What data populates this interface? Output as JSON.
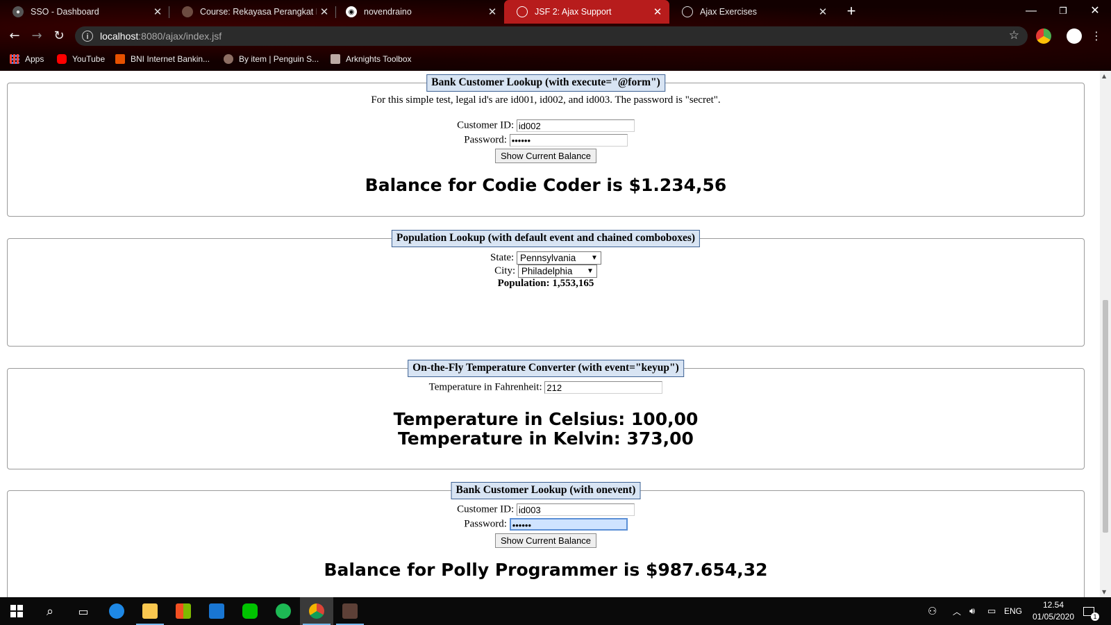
{
  "browser": {
    "tabs": [
      {
        "title": "SSO - Dashboard",
        "icon": "sso-icon",
        "active": false
      },
      {
        "title": "Course: Rekayasa Perangkat Luna",
        "icon": "course-icon",
        "active": false
      },
      {
        "title": "novendraino",
        "icon": "github-icon",
        "active": false
      },
      {
        "title": "JSF 2: Ajax Support",
        "icon": "globe-icon",
        "active": true
      },
      {
        "title": "Ajax Exercises",
        "icon": "globe-icon",
        "active": false
      }
    ],
    "new_tab": "+",
    "window_controls": {
      "minimize": "—",
      "restore": "❐",
      "close": "✕"
    },
    "address": {
      "host": "localhost",
      "rest": ":8080/ajax/index.jsf"
    },
    "bookmarks": [
      {
        "label": "Apps",
        "icon": "apps-grid-icon"
      },
      {
        "label": "YouTube",
        "icon": "youtube-icon"
      },
      {
        "label": "BNI Internet Bankin...",
        "icon": "bni-icon"
      },
      {
        "label": "By item | Penguin S...",
        "icon": "penguin-icon"
      },
      {
        "label": "Arknights Toolbox",
        "icon": "arknights-icon"
      }
    ]
  },
  "sections": {
    "bank1": {
      "legend": "Bank Customer Lookup (with execute=\"@form\")",
      "note": "For this simple test, legal id's are id001, id002, and id003. The password is \"secret\".",
      "customer_id_label": "Customer ID:",
      "customer_id_value": "id002",
      "password_label": "Password:",
      "password_value": "••••••",
      "button": "Show Current Balance",
      "result": "Balance for Codie Coder is $1.234,56"
    },
    "population": {
      "legend": "Population Lookup (with default event and chained comboboxes)",
      "state_label": "State:",
      "state_value": "Pennsylvania",
      "city_label": "City:",
      "city_value": "Philadelphia",
      "population_label": "Population:",
      "population_value": "1,553,165"
    },
    "temperature": {
      "legend": "On-the-Fly Temperature Converter (with event=\"keyup\")",
      "fahrenheit_label": "Temperature in Fahrenheit:",
      "fahrenheit_value": "212",
      "celsius": "Temperature in Celsius: 100,00",
      "kelvin": "Temperature in Kelvin: 373,00"
    },
    "bank2": {
      "legend": "Bank Customer Lookup (with onevent)",
      "customer_id_label": "Customer ID:",
      "customer_id_value": "id003",
      "password_label": "Password:",
      "password_value": "••••••",
      "button": "Show Current Balance",
      "result": "Balance for Polly Programmer is $987.654,32"
    }
  },
  "taskbar": {
    "lang": "ENG",
    "time": "12.54",
    "date": "01/05/2020",
    "notifications": "1"
  },
  "colors": {
    "chrome_bg": "#120000",
    "active_tab": "#b71c1c",
    "legend_bg": "#d8e4f3",
    "legend_border": "#3d6193"
  }
}
